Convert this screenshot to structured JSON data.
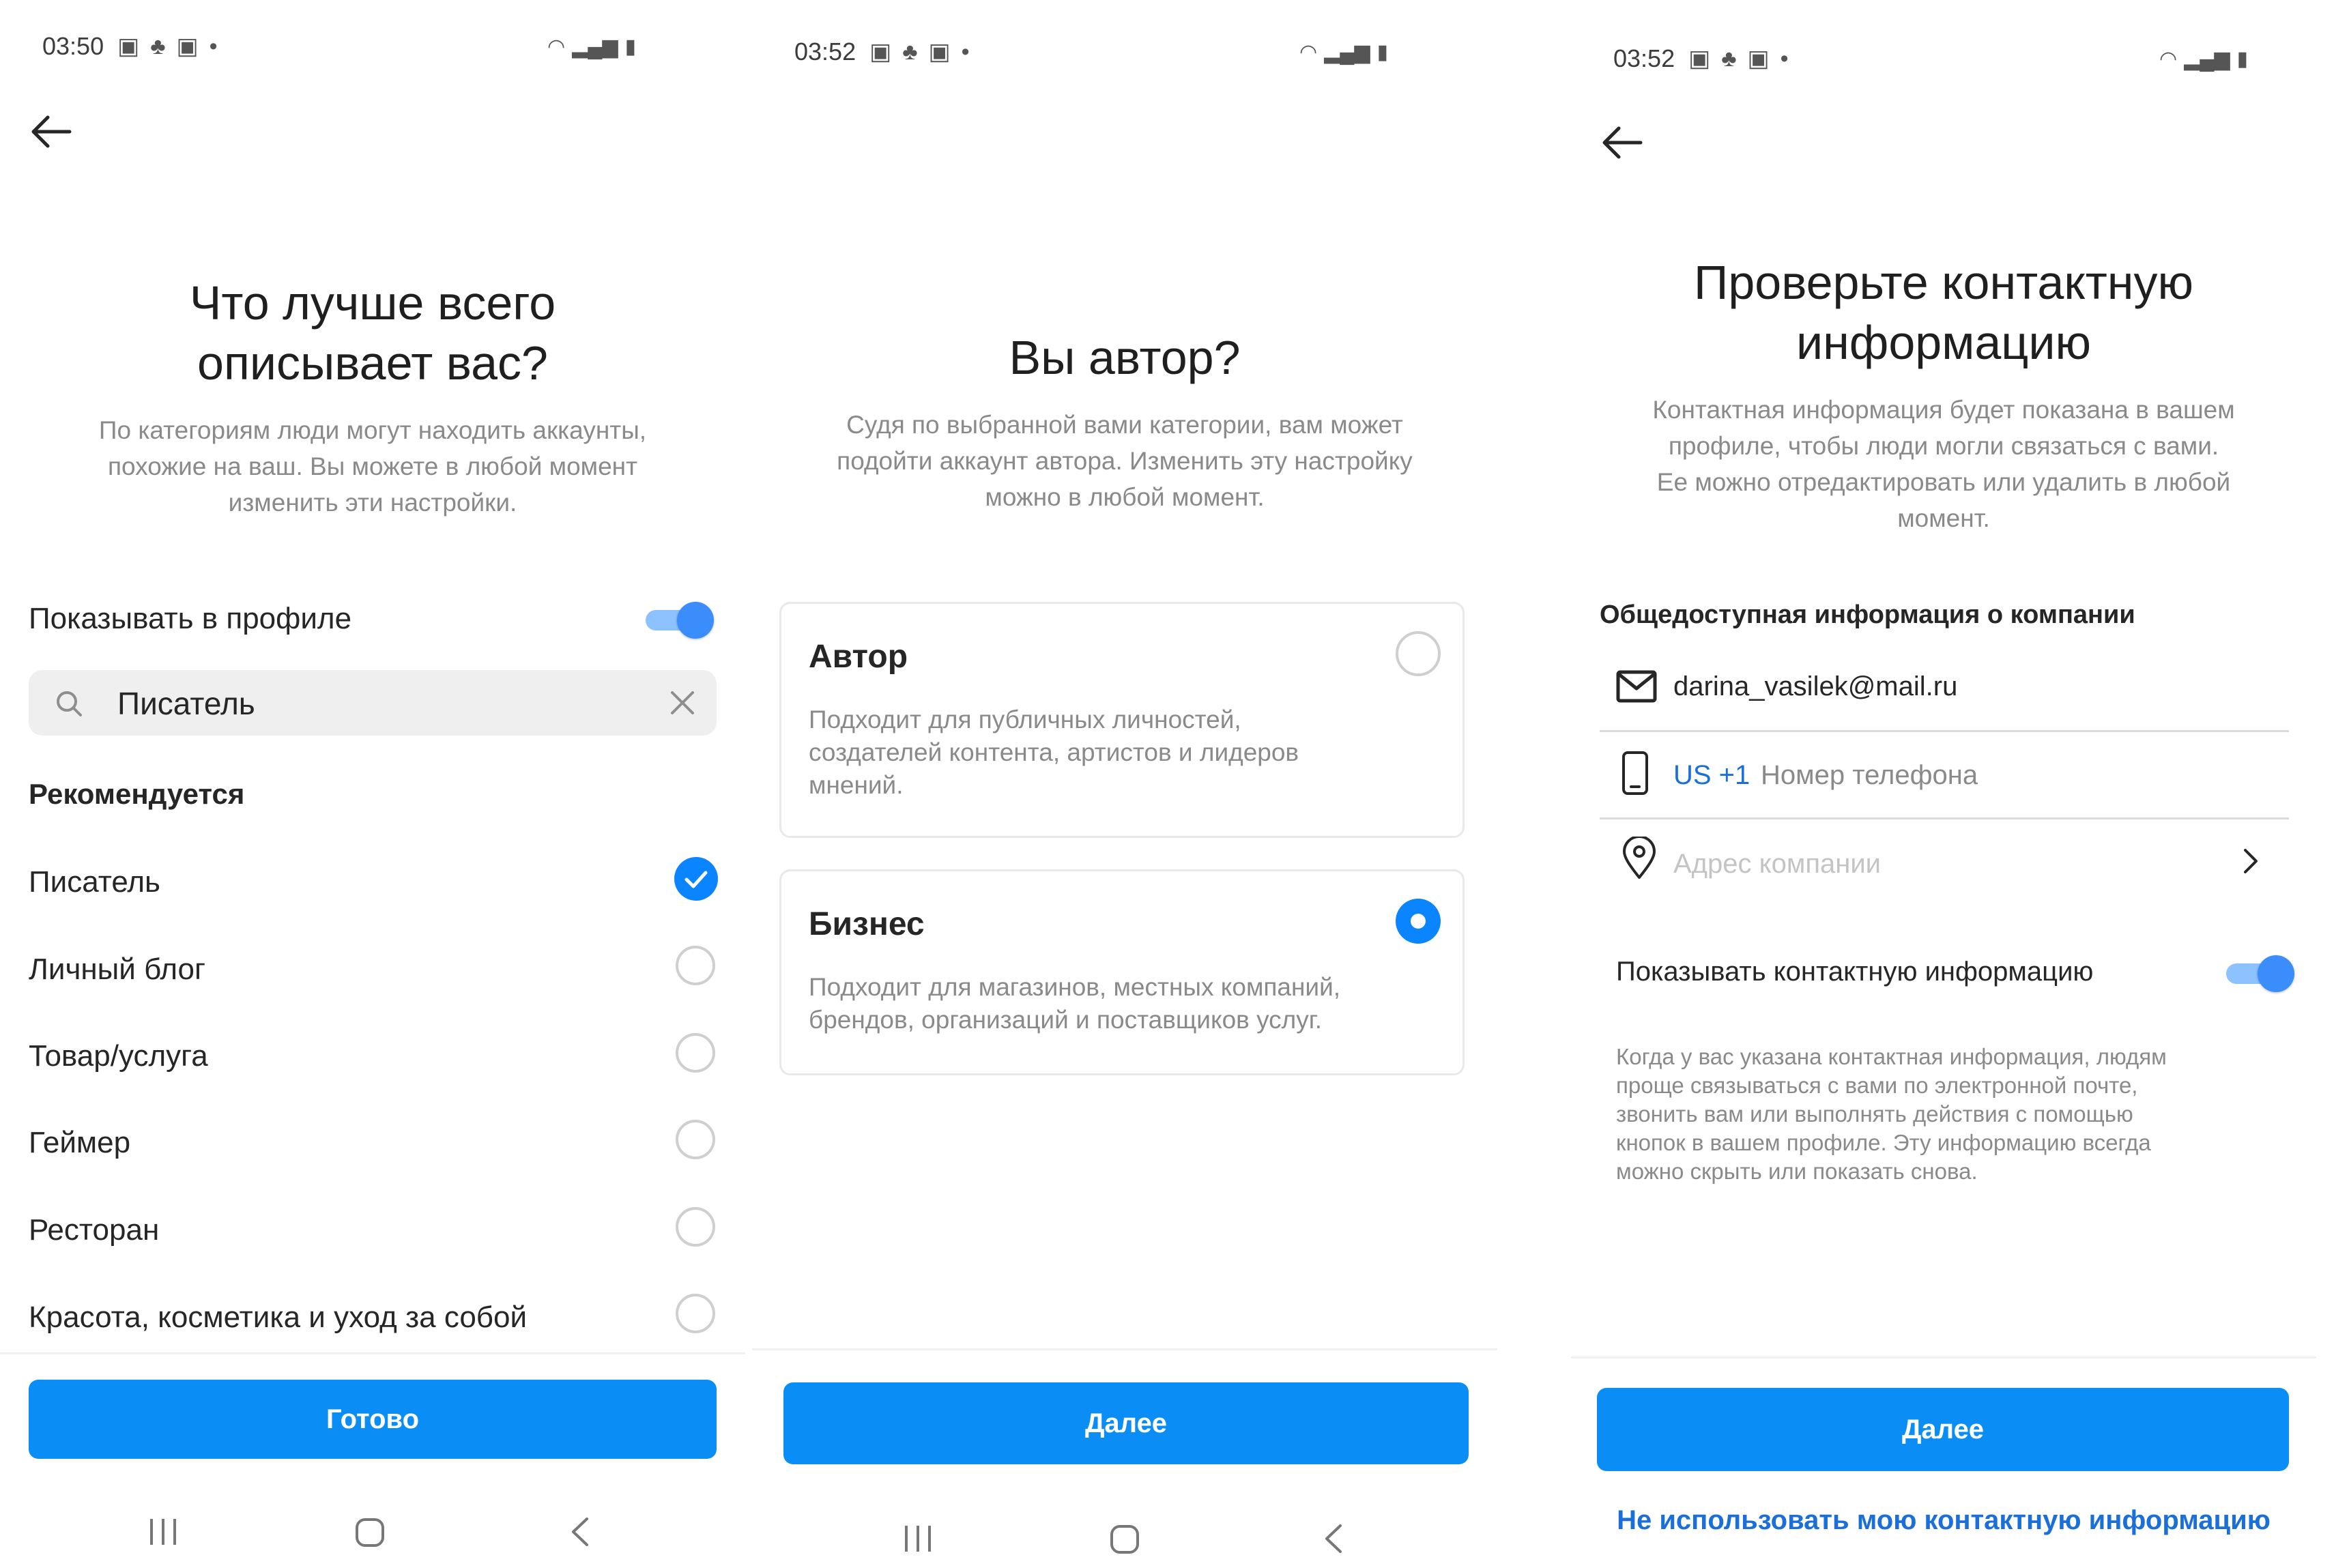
{
  "status_bars": [
    {
      "time": "03:50"
    },
    {
      "time": "03:52"
    },
    {
      "time": "03:52"
    }
  ],
  "screen1": {
    "title_line1": "Что лучше всего",
    "title_line2": "описывает вас?",
    "subtitle_lines": [
      "По категориям люди могут находить аккаунты,",
      "похожие на ваш. Вы можете в любой момент",
      "изменить эти настройки."
    ],
    "show_in_profile_label": "Показывать в профиле",
    "show_in_profile_on": true,
    "search_value": "Писатель",
    "recommended_header": "Рекомендуется",
    "categories": [
      {
        "label": "Писатель",
        "selected": true
      },
      {
        "label": "Личный блог",
        "selected": false
      },
      {
        "label": "Товар/услуга",
        "selected": false
      },
      {
        "label": "Геймер",
        "selected": false
      },
      {
        "label": "Ресторан",
        "selected": false
      },
      {
        "label": "Красота, косметика и уход за собой",
        "selected": false
      }
    ],
    "done_button": "Готово"
  },
  "screen2": {
    "title": "Вы автор?",
    "subtitle_lines": [
      "Судя по выбранной вами категории, вам может",
      "подойти аккаунт автора. Изменить эту настройку",
      "можно в любой момент."
    ],
    "options": [
      {
        "title": "Автор",
        "desc_lines": [
          "Подходит для публичных личностей,",
          "создателей контента, артистов и лидеров",
          "мнений."
        ],
        "selected": false
      },
      {
        "title": "Бизнес",
        "desc_lines": [
          "Подходит для магазинов, местных компаний,",
          "брендов, организаций и поставщиков услуг."
        ],
        "selected": true
      }
    ],
    "next_button": "Далее"
  },
  "screen3": {
    "title_line1": "Проверьте контактную",
    "title_line2": "информацию",
    "subtitle_lines": [
      "Контактная информация будет показана в вашем",
      "профиле, чтобы люди могли связаться с вами.",
      "Ее можно отредактировать или удалить в любой",
      "момент."
    ],
    "section_header": "Общедоступная информация о компании",
    "email_value": "darina_vasilek@mail.ru",
    "phone_country": "US +1",
    "phone_placeholder": "Номер телефона",
    "address_placeholder": "Адрес компании",
    "show_contact_label": "Показывать контактную информацию",
    "show_contact_on": true,
    "info_lines": [
      "Когда у вас указана контактная информация, людям",
      "проще связываться с вами по электронной почте,",
      "звонить вам или выполнять действия с помощью",
      "кнопок в вашем профиле. Эту информацию всегда",
      "можно скрыть или показать снова."
    ],
    "next_button": "Далее",
    "skip_link": "Не использовать мою контактную информацию"
  },
  "colors": {
    "accent": "#0a8ef5",
    "link": "#1a6fd9",
    "toggle_knob": "#3a8dfa",
    "check": "#0a84ff"
  }
}
